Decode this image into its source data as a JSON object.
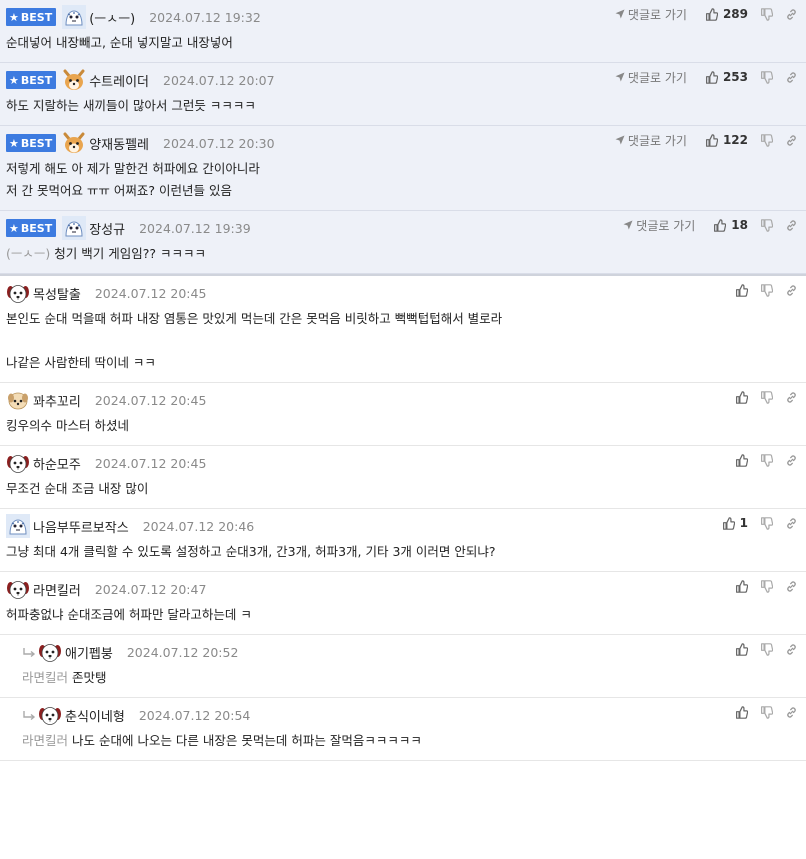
{
  "best_label": "BEST",
  "goto_label": "댓글로 가기",
  "comments": [
    {
      "best": true,
      "nick": "(ㅡㅅㅡ)",
      "avatar": "tiger-avatar",
      "date": "2024.07.12 19:32",
      "likes": "289",
      "lines": [
        "순대넣어 내장빼고, 순대 넣지말고 내장넣어"
      ]
    },
    {
      "best": true,
      "nick": "수트레이더",
      "avatar": "shiba-avatar",
      "date": "2024.07.12 20:07",
      "likes": "253",
      "lines": [
        "하도 지랄하는 새끼들이 많아서 그런듯 ㅋㅋㅋㅋ"
      ]
    },
    {
      "best": true,
      "nick": "양재동펠레",
      "avatar": "shiba-avatar",
      "date": "2024.07.12 20:30",
      "likes": "122",
      "lines": [
        "저렇게 해도 아 제가 말한건 허파에요 간이아니라",
        "저 간 못먹어요 ㅠㅠ 어쩌죠? 이런년들 있음"
      ]
    },
    {
      "best": true,
      "nick": "장성규",
      "avatar": "tiger-avatar",
      "date": "2024.07.12 19:39",
      "likes": "18",
      "mention": "(ㅡㅅㅡ)",
      "lines": [
        "청기 백기 게임임?? ㅋㅋㅋㅋ"
      ]
    },
    {
      "best": false,
      "nick": "목성탈출",
      "avatar": "dog-avatar",
      "date": "2024.07.12 20:45",
      "likes": "",
      "lines": [
        "본인도 순대 먹을때 허파 내장 염통은 맛있게 먹는데 간은 못먹음 비릿하고 뻑뻑텁텁해서 별로라",
        "",
        "나같은 사람한테 딱이네 ㅋㅋ"
      ]
    },
    {
      "best": false,
      "nick": "꽈추꼬리",
      "avatar": "puppy-avatar",
      "date": "2024.07.12 20:45",
      "likes": "",
      "lines": [
        "킹우의수 마스터 하셨네"
      ]
    },
    {
      "best": false,
      "nick": "하순모주",
      "avatar": "dog-avatar",
      "date": "2024.07.12 20:45",
      "likes": "",
      "lines": [
        "무조건 순대 조금 내장 많이"
      ]
    },
    {
      "best": false,
      "nick": "나음부뚜르보작스",
      "avatar": "tiger-avatar",
      "date": "2024.07.12 20:46",
      "likes": "1",
      "lines": [
        "그냥 최대 4개 클릭할 수 있도록 설정하고 순대3개, 간3개, 허파3개, 기타 3개 이러면 안되냐?"
      ]
    },
    {
      "best": false,
      "nick": "라면킬러",
      "avatar": "dog-avatar",
      "date": "2024.07.12 20:47",
      "likes": "",
      "lines": [
        "허파충없냐 순대조금에 허파만 달라고하는데 ㅋ"
      ]
    },
    {
      "best": false,
      "reply": true,
      "nick": "애기펩붕",
      "avatar": "dog-avatar",
      "date": "2024.07.12 20:52",
      "likes": "",
      "mention": "라면킬러",
      "lines": [
        "존맛탱"
      ]
    },
    {
      "best": false,
      "reply": true,
      "nick": "춘식이네형",
      "avatar": "dog-avatar",
      "date": "2024.07.12 20:54",
      "likes": "",
      "mention": "라면킬러",
      "lines": [
        "나도 순대에 나오는 다른 내장은 못먹는데 허파는 잘먹음ㅋㅋㅋㅋㅋ"
      ]
    }
  ]
}
